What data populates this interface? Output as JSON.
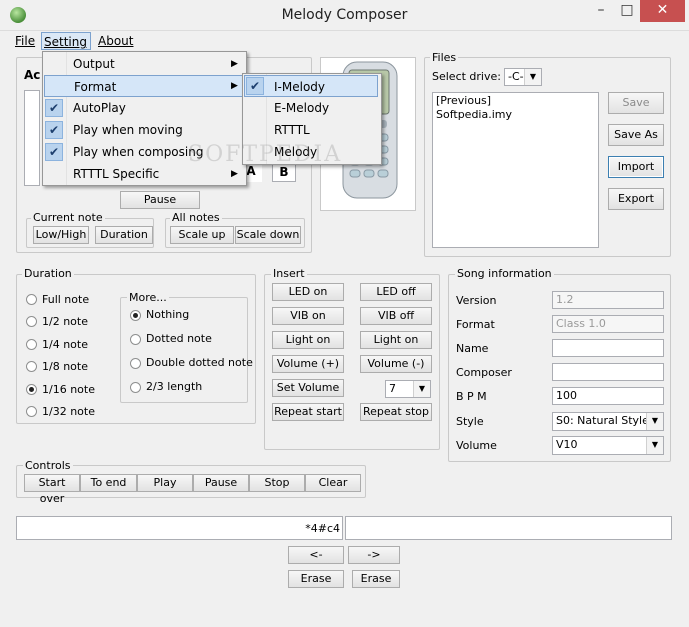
{
  "window": {
    "title": "Melody Composer",
    "minimize": "–",
    "maximize": "□",
    "close": "✕"
  },
  "menubar": {
    "file": "File",
    "setting": "Setting",
    "about": "About"
  },
  "setting_menu": {
    "items": [
      {
        "label": "Output",
        "checked": false,
        "submenu": true
      },
      {
        "label": "Format",
        "checked": false,
        "submenu": true
      },
      {
        "label": "AutoPlay",
        "checked": true,
        "submenu": false
      },
      {
        "label": "Play when moving",
        "checked": true,
        "submenu": false
      },
      {
        "label": "Play when composing",
        "checked": true,
        "submenu": false
      },
      {
        "label": "RTTTL Specific",
        "checked": false,
        "submenu": true
      }
    ]
  },
  "format_submenu": {
    "items": [
      {
        "label": "I-Melody",
        "checked": true
      },
      {
        "label": "E-Melody",
        "checked": false
      },
      {
        "label": "RTTTL",
        "checked": false
      },
      {
        "label": "Melody",
        "checked": false
      }
    ]
  },
  "partial": {
    "ac": "Ac",
    "a": "A",
    "b": "B"
  },
  "pause_button": "Pause",
  "current_note": {
    "title": "Current note",
    "low_high": "Low/High",
    "duration": "Duration"
  },
  "all_notes": {
    "title": "All notes",
    "scale_up": "Scale up",
    "scale_down": "Scale down"
  },
  "files": {
    "title": "Files",
    "select_drive_label": "Select drive:",
    "drive_value": "-C-",
    "list": [
      "[Previous]",
      "Softpedia.imy"
    ],
    "save": "Save",
    "save_as": "Save As",
    "import": "Import",
    "export": "Export"
  },
  "duration": {
    "title": "Duration",
    "options": [
      "Full note",
      "1/2 note",
      "1/4 note",
      "1/8 note",
      "1/16 note",
      "1/32 note"
    ],
    "selected": "1/16 note",
    "more": {
      "title": "More...",
      "options": [
        "Nothing",
        "Dotted note",
        "Double dotted note",
        "2/3 length"
      ],
      "selected": "Nothing"
    }
  },
  "insert": {
    "title": "Insert",
    "led_on": "LED on",
    "led_off": "LED off",
    "vib_on": "VIB on",
    "vib_off": "VIB off",
    "light_on": "Light on",
    "light_off": "Light on",
    "volume_plus": "Volume (+)",
    "volume_minus": "Volume (-)",
    "set_volume": "Set Volume",
    "volume_value": "7",
    "repeat_start": "Repeat start",
    "repeat_stop": "Repeat stop"
  },
  "song_info": {
    "title": "Song information",
    "version_label": "Version",
    "version_value": "1.2",
    "format_label": "Format",
    "format_value": "Class 1.0",
    "name_label": "Name",
    "name_value": "",
    "composer_label": "Composer",
    "composer_value": "",
    "bpm_label": "B P M",
    "bpm_value": "100",
    "style_label": "Style",
    "style_value": "S0: Natural Style",
    "volume_label": "Volume",
    "volume_value": "V10"
  },
  "controls": {
    "title": "Controls",
    "buttons": [
      "Start over",
      "To end",
      "Play",
      "Pause",
      "Stop",
      "Clear"
    ]
  },
  "notes_text": "*4#c4",
  "nav": {
    "left": "<-",
    "right": "->",
    "erase_left": "Erase",
    "erase_right": "Erase"
  },
  "watermark": "SOFTPEDIA"
}
